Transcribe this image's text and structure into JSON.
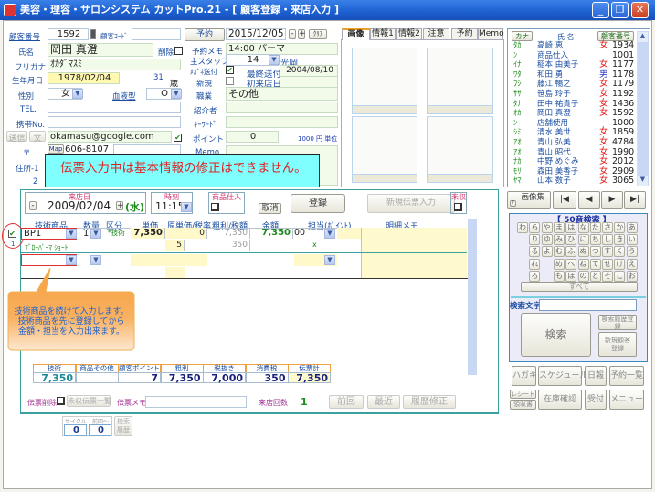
{
  "window": {
    "title": "美容・理容・サロンシステム カットPro.21 - [ 顧客登録・来店入力 ]",
    "buttons": [
      "_",
      "❐",
      "✕"
    ]
  },
  "customer": {
    "number_label": "顧客番号",
    "number": "1592",
    "code_label": "顧客ｺｰﾄﾞ",
    "code": "",
    "name_label": "氏名",
    "name": "岡田 真澄",
    "delete_label": "削除",
    "kana_label": "フリガナ",
    "kana": "ｵｶﾀﾞﾏｽﾐ",
    "birth_label": "生年月日",
    "birth": "1978/02/04",
    "age": "31",
    "age_unit": "歳",
    "sex_label": "性別",
    "sex": "女",
    "blood_label": "血液型",
    "blood": "O",
    "tel_label": "TEL.",
    "tel": "",
    "mobile_label": "携帯No.",
    "mobile": "",
    "send_label": "送信",
    "text_label": "文",
    "email": "okamasu@google.com",
    "zip_label": "〒",
    "map_label": "Map",
    "zip": "606-8107",
    "zip2": "",
    "addr1_label": "住所-1",
    "addr2_label": "2"
  },
  "middle": {
    "reserve_button": "予約",
    "reserve_date": "2015/12/05",
    "minus": "-",
    "plus": "+",
    "clear": "ｸﾘｱ",
    "memo_label": "予約メモ",
    "memo": "14:00 パーマ",
    "staff_label": "主スタッフ",
    "staff_no": "14",
    "staff_name": "光岡",
    "dm_label": "ﾒｶﾞﾈ送付",
    "last_send_label": "最終送付",
    "last_send": "2004/08/10",
    "new_label": "新規",
    "first_visit_label": "初来店日",
    "first_visit": "",
    "job_label": "職業",
    "job": "その他",
    "intro_label": "紹介者",
    "intro": "",
    "keyword_label": "ｷｰﾜｰﾄﾞ",
    "keyword": "",
    "point_label": "ポイント",
    "point": "0",
    "point_unit": "1000 円 単位",
    "memo2_label": "Memo"
  },
  "message": "伝票入力中は基本情報の修正はできません。",
  "tabs": [
    "画像",
    "情報1",
    "情報2",
    "注意",
    "予約",
    "Memo"
  ],
  "list": {
    "header": {
      "kana": "カナ",
      "name": "氏 名",
      "number": "顧客番号"
    },
    "rows": [
      {
        "kana": "ﾀｶ",
        "name": "高崎 恵",
        "sex": "女",
        "no": "1934"
      },
      {
        "kana": "ﾝ",
        "name": "商品仕入",
        "sex": "",
        "no": "1001"
      },
      {
        "kana": "ｲﾅ",
        "name": "稲本 由美子",
        "sex": "女",
        "no": "1177"
      },
      {
        "kana": "ﾜﾀ",
        "name": "和田 勇",
        "sex": "男",
        "no": "1178"
      },
      {
        "kana": "ﾌｼ",
        "name": "藤江 暢之",
        "sex": "女",
        "no": "1179"
      },
      {
        "kana": "ｻｻ",
        "name": "笹島 玲子",
        "sex": "女",
        "no": "1192"
      },
      {
        "kana": "ﾀﾅ",
        "name": "田中 祐貴子",
        "sex": "女",
        "no": "1436"
      },
      {
        "kana": "ｵｶ",
        "name": "岡田 真澄",
        "sex": "女",
        "no": "1592"
      },
      {
        "kana": "ﾝ",
        "name": "店舗使用",
        "sex": "",
        "no": "1000"
      },
      {
        "kana": "ｼﾐ",
        "name": "清水 美世",
        "sex": "女",
        "no": "1859"
      },
      {
        "kana": "ｱｵ",
        "name": "青山 弘美",
        "sex": "女",
        "no": "4784"
      },
      {
        "kana": "ｱｵ",
        "name": "青山 昭代",
        "sex": "女",
        "no": "1990"
      },
      {
        "kana": "ﾅｶ",
        "name": "中野 めぐみ",
        "sex": "女",
        "no": "2012"
      },
      {
        "kana": "ﾓﾘ",
        "name": "森田 美香子",
        "sex": "女",
        "no": "2909"
      },
      {
        "kana": "ﾔﾏ",
        "name": "山本 数子",
        "sex": "女",
        "no": "3065"
      }
    ]
  },
  "slip": {
    "visit_label": "来店日",
    "visit_date": "2009/02/04",
    "weekday": "(水)",
    "time_label": "時刻",
    "time": "11:15",
    "stock_label": "商品仕入",
    "cancel": "取消",
    "register": "登録",
    "new_slip": "新規伝票入力",
    "unpaid_label": "未収",
    "columns": [
      "技術商品",
      "数量",
      "区分",
      "単価",
      "原単価/税率",
      "粗利/税額",
      "金額",
      "担当(ﾎﾟｲﾝﾄ)",
      "明細メモ"
    ],
    "row_no": "1",
    "row": {
      "item": "BP1",
      "qty": "1",
      "kind": "*技術",
      "price": "7,350",
      "cost": "0",
      "profit": "7,350",
      "amount": "7,350",
      "staff": "00",
      "item_name": "ﾌﾞﾛｰﾊﾟｰﾏ ｼｮｰﾄ",
      "tax_rate": "5",
      "tax": "350",
      "point": "x"
    },
    "tooltip": [
      "技術商品を続けて入力します。",
      "技術商品を先に登録してから",
      "金額・担当を入力出来ます。"
    ],
    "totals": [
      {
        "label": "技術",
        "value": "7,350"
      },
      {
        "label": "商品その他",
        "value": ""
      },
      {
        "label": "顧客ポイント",
        "value": "7"
      },
      {
        "label": "粗利",
        "value": "7,350"
      },
      {
        "label": "税抜き",
        "value": "7,000"
      },
      {
        "label": "消費税",
        "value": "350"
      },
      {
        "label": "伝票計",
        "value": "7,350"
      }
    ],
    "delete_label": "伝票削除",
    "unpaid_list": "未収伝票一覧",
    "memo_label": "伝票メモ",
    "memo": "",
    "visits_label": "来店回数",
    "visits": "1",
    "prev": "前回",
    "recent": "最近",
    "history_edit": "履歴修正"
  },
  "cycle": {
    "cycle_label": "サイクル",
    "since_label": "前回～",
    "cycle": "0",
    "since": "0",
    "history": "検索履歴"
  },
  "right": {
    "help": "?",
    "gallery": "画像集",
    "nav": [
      "|◀",
      "◀",
      "▶",
      "▶|"
    ],
    "search_title": "【 50音検索 】",
    "kana_rows": [
      [
        "わ",
        "ら",
        "や",
        "ま",
        "は",
        "な",
        "た",
        "さ",
        "か",
        "あ"
      ],
      [
        "",
        "り",
        "ゆ",
        "み",
        "ひ",
        "に",
        "ち",
        "し",
        "き",
        "い"
      ],
      [
        "",
        "る",
        "よ",
        "む",
        "ふ",
        "ぬ",
        "つ",
        "す",
        "く",
        "う"
      ],
      [
        "",
        "れ",
        "",
        "め",
        "へ",
        "ね",
        "て",
        "せ",
        "け",
        "え"
      ],
      [
        "",
        "ろ",
        "",
        "も",
        "ほ",
        "の",
        "と",
        "そ",
        "こ",
        "お"
      ]
    ],
    "all": "すべて",
    "search_text_label": "検索文字",
    "search_text": "",
    "search": "検索",
    "history_reg": "検索履歴登録",
    "new_customer": "新規顧客登録",
    "buttons1": [
      "ハガキ",
      "スケジュール",
      "日報",
      "予約一覧"
    ],
    "receipt": "レシート",
    "invoice": "領収書",
    "buttons2": [
      "在庫確認",
      "受付",
      "メニュー"
    ]
  },
  "colors": {
    "title": "#1c5fd0",
    "message_bg": "#80ffff",
    "message_text": "#e02020",
    "tooltip": "#f8a040",
    "accent": "#1a4da0"
  }
}
